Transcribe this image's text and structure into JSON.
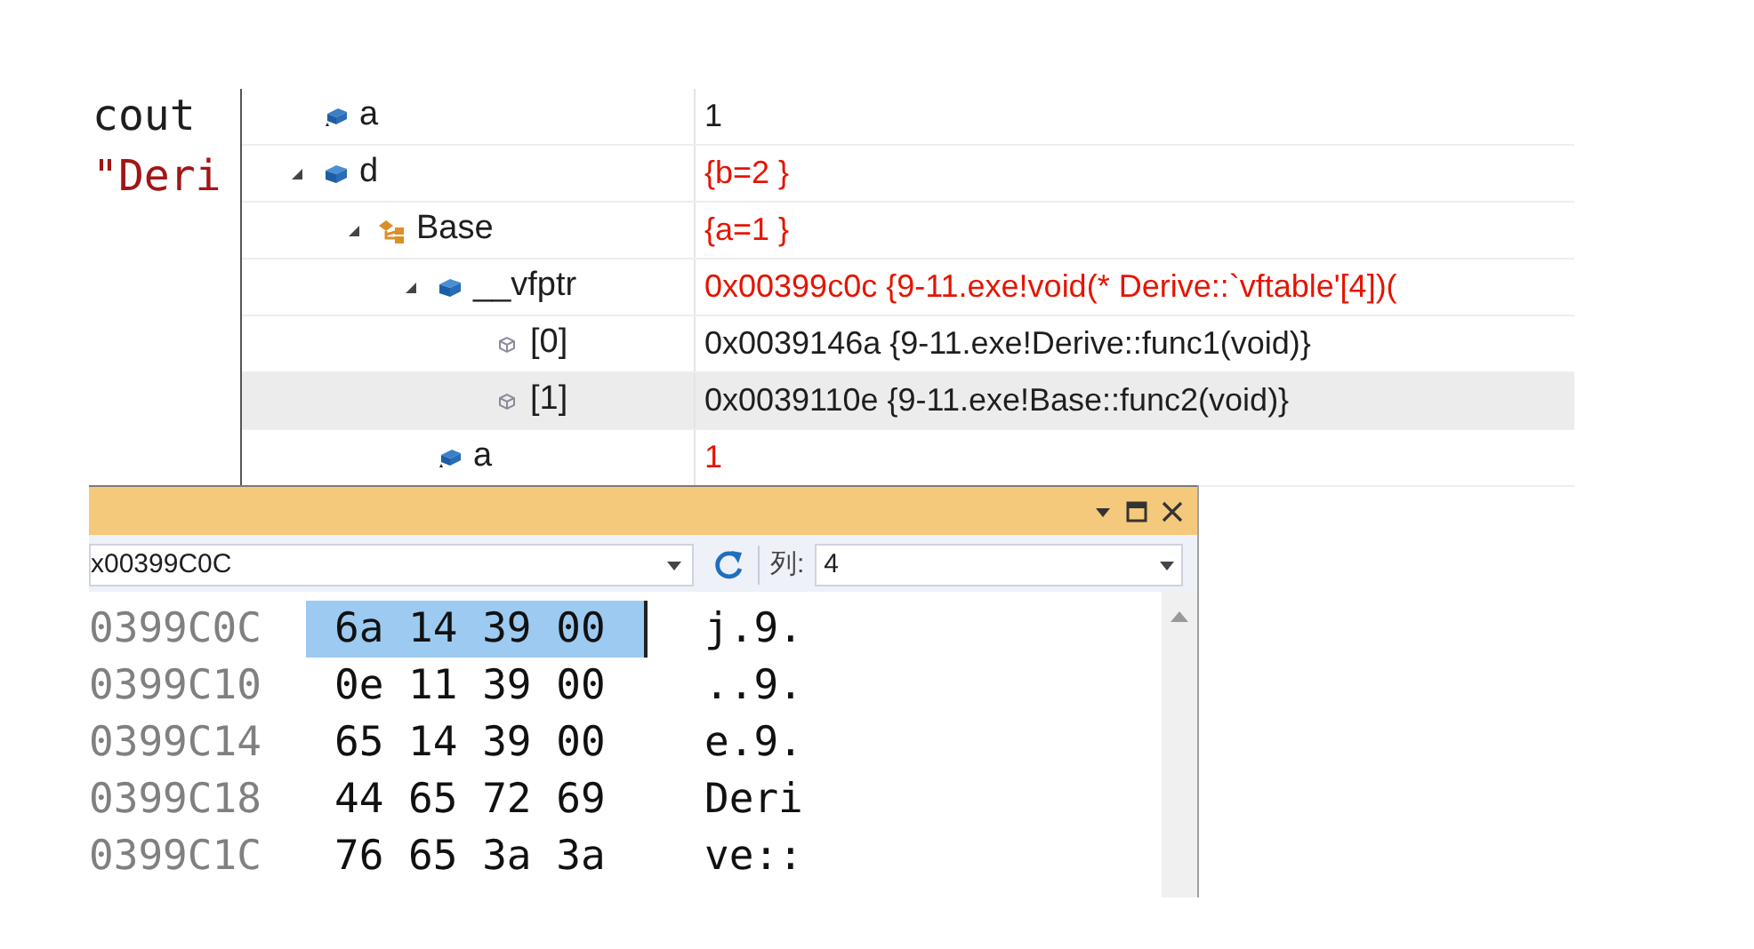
{
  "editor": {
    "lines": [
      {
        "text": "cout",
        "kind": "plain"
      },
      {
        "text": "\"Deri",
        "kind": "string"
      }
    ]
  },
  "watch": {
    "items": [
      {
        "name": "a",
        "value": "1",
        "kind": "field",
        "changed": false,
        "selected": false
      },
      {
        "name": "d",
        "value": "{b=2 }",
        "kind": "object",
        "changed": true,
        "selected": false,
        "expanded": true,
        "children": [
          {
            "name": "Base",
            "value": "{a=1 }",
            "kind": "base",
            "changed": true,
            "selected": false,
            "expanded": true,
            "children": [
              {
                "name": "__vfptr",
                "value": "0x00399c0c {9-11.exe!void(* Derive::`vftable'[4])(",
                "kind": "object",
                "changed": true,
                "selected": false,
                "expanded": true,
                "children": [
                  {
                    "name": "[0]",
                    "value": "0x0039146a {9-11.exe!Derive::func1(void)}",
                    "kind": "element",
                    "changed": false,
                    "selected": false
                  },
                  {
                    "name": "[1]",
                    "value": "0x0039110e {9-11.exe!Base::func2(void)}",
                    "kind": "element",
                    "changed": false,
                    "selected": true
                  }
                ]
              },
              {
                "name": "a",
                "value": "1",
                "kind": "field",
                "changed": true,
                "selected": false
              }
            ]
          }
        ]
      }
    ]
  },
  "memory": {
    "address": "x00399C0C",
    "columns_label": "列:",
    "columns": "4",
    "rows": [
      {
        "address": "0399C0C",
        "bytes": [
          "6a",
          "14",
          "39",
          "00"
        ],
        "text": "j.9.",
        "selected": true
      },
      {
        "address": "0399C10",
        "bytes": [
          "0e",
          "11",
          "39",
          "00"
        ],
        "text": "..9.",
        "selected": false
      },
      {
        "address": "0399C14",
        "bytes": [
          "65",
          "14",
          "39",
          "00"
        ],
        "text": "e.9.",
        "selected": false
      },
      {
        "address": "0399C18",
        "bytes": [
          "44",
          "65",
          "72",
          "69"
        ],
        "text": "Deri",
        "selected": false
      },
      {
        "address": "0399C1C",
        "bytes": [
          "76",
          "65",
          "3a",
          "3a"
        ],
        "text": "ve::",
        "selected": false
      }
    ]
  }
}
